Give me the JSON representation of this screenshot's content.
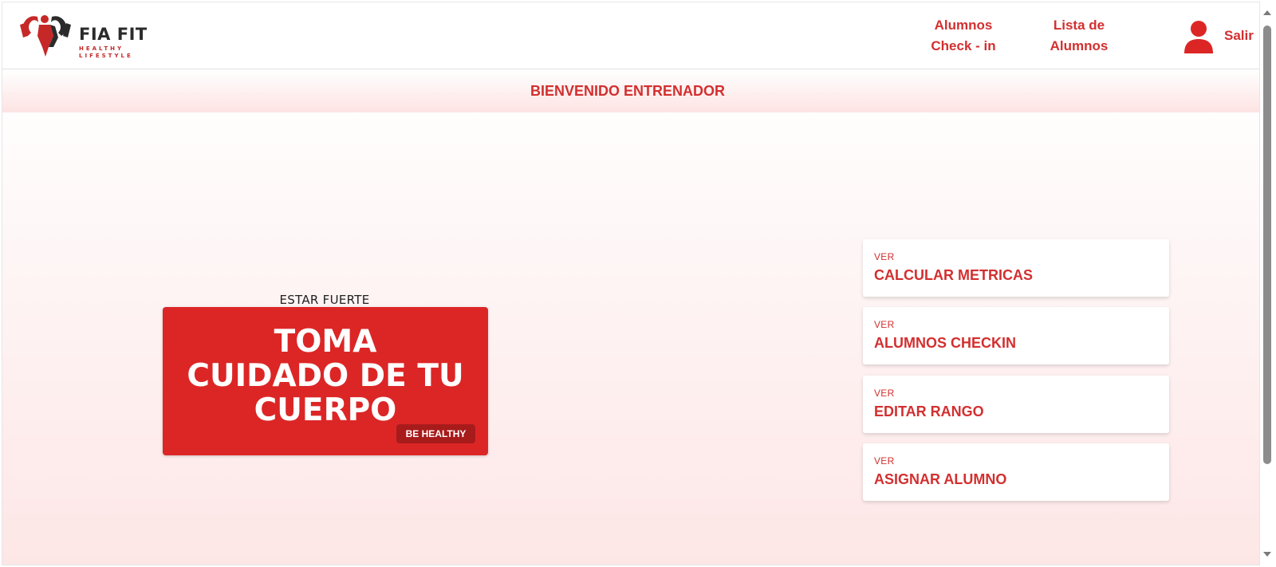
{
  "brand": {
    "name": "FIA FIT",
    "tagline": "HEALTHY LIFESTYLE",
    "logo_icon": "flexing-athlete-icon"
  },
  "nav": {
    "checkin_label": "Alumnos\nCheck - in",
    "lista_label": "Lista de\nAlumnos",
    "user_icon": "user-icon",
    "logout_label": "Salir"
  },
  "welcome": {
    "text": "BIENVENIDO ENTRENADOR"
  },
  "hero": {
    "caption": "ESTAR FUERTE",
    "title": "TOMA\nCUIDADO DE TU\nCUERPO",
    "badge": "BE HEALTHY"
  },
  "actions": [
    {
      "kicker": "VER",
      "title": "CALCULAR METRICAS"
    },
    {
      "kicker": "VER",
      "title": "ALUMNOS CHECKIN"
    },
    {
      "kicker": "VER",
      "title": "EDITAR RANGO"
    },
    {
      "kicker": "VER",
      "title": "ASIGNAR ALUMNO"
    }
  ],
  "colors": {
    "accent": "#d32f2f",
    "hero_bg": "#dc2626",
    "badge_bg": "#a81b1b"
  }
}
